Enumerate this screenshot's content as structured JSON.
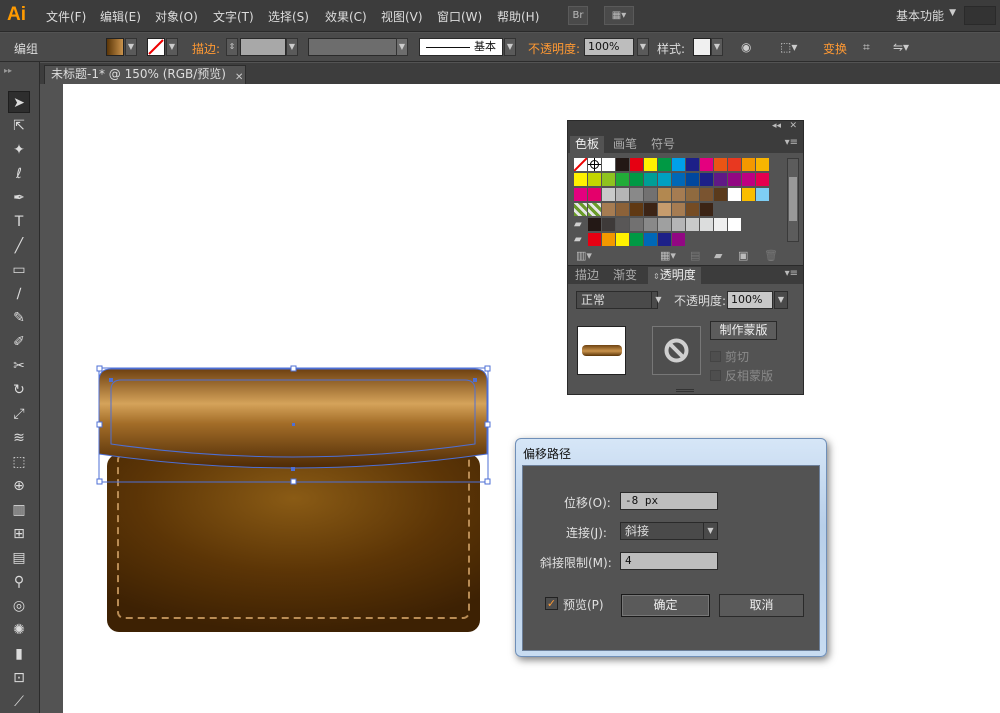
{
  "app": {
    "logo": "Ai"
  },
  "menu": {
    "items": [
      "文件(F)",
      "编辑(E)",
      "对象(O)",
      "文字(T)",
      "选择(S)",
      "效果(C)",
      "视图(V)",
      "窗口(W)",
      "帮助(H)"
    ],
    "bridge_label": "Br",
    "workspace": "基本功能"
  },
  "control": {
    "selection": "编组",
    "stroke_label": "描边:",
    "stroke_style": "基本",
    "opacity_label": "不透明度:",
    "opacity_value": "100%",
    "style_label": "样式:",
    "transform_label": "变换"
  },
  "document": {
    "tab_title": "未标题-1* @ 150% (RGB/预览)"
  },
  "tools": [
    "selection-tool",
    "direct-selection-tool",
    "magic-wand-tool",
    "lasso-tool",
    "pen-tool",
    "type-tool",
    "line-tool",
    "rectangle-tool",
    "paintbrush-tool",
    "pencil-tool",
    "blob-brush-tool",
    "scissors-tool",
    "rotate-tool",
    "scale-tool",
    "width-tool",
    "free-transform-tool",
    "shape-builder-tool",
    "perspective-grid-tool",
    "mesh-tool",
    "gradient-tool",
    "eyedropper-tool",
    "blend-tool",
    "symbol-sprayer-tool",
    "column-graph-tool",
    "artboard-tool",
    "slice-tool"
  ],
  "swatches": {
    "tabs": [
      "色板",
      "画笔",
      "符号"
    ],
    "rows": [
      [
        "none",
        "registration",
        "#ffffff",
        "#231815",
        "#e60012",
        "#fff100",
        "#009944",
        "#00a0e9",
        "#1d2088",
        "#e4007f",
        "#ea5514",
        "#e83820",
        "#f39800",
        "#f8b500"
      ],
      [
        "#fff100",
        "#c3d600",
        "#8fc31f",
        "#22ac38",
        "#009944",
        "#009e96",
        "#00a0c1",
        "#0068b7",
        "#00479d",
        "#1d2088",
        "#601986",
        "#920783",
        "#be0081",
        "#e5004f"
      ],
      [
        "#e4007f",
        "#e4006b",
        "#c9caca",
        "#b5b5b6",
        "#898989",
        "#727171",
        "#b28850",
        "#a57c52",
        "#8f6a3f",
        "#7a5430",
        "#5a3a1c",
        "#ffffff",
        "#fabe00",
        "#7ecef4"
      ],
      [
        "pattern",
        "pattern",
        "#a67c52",
        "#8c6239",
        "#603913",
        "#3c2415",
        "#c69c6d",
        "#a67c52",
        "#754c24",
        "#3c2415"
      ],
      [
        "folder",
        "#231815",
        "#3e3a39",
        "#595757",
        "#727171",
        "#898989",
        "#9fa0a0",
        "#b5b5b6",
        "#c9caca",
        "#dcdddd",
        "#efefef",
        "#ffffff"
      ],
      [
        "folder",
        "#e60012",
        "#f39800",
        "#fff100",
        "#009944",
        "#0068b7",
        "#1d2088",
        "#920783"
      ]
    ]
  },
  "transparency": {
    "tabs": [
      "描边",
      "渐变",
      "透明度"
    ],
    "blend_mode": "正常",
    "opacity_label": "不透明度:",
    "opacity_value": "100%",
    "make_mask": "制作蒙版",
    "clip": "剪切",
    "invert_mask": "反相蒙版"
  },
  "dialog": {
    "title": "偏移路径",
    "offset_label": "位移(O):",
    "offset_value": "-8 px",
    "joins_label": "连接(J):",
    "joins_value": "斜接",
    "miter_label": "斜接限制(M):",
    "miter_value": "4",
    "preview_label": "预览(P)",
    "preview_checked": "✓",
    "ok": "确定",
    "cancel": "取消"
  },
  "colors": {
    "accent": "#ff9a00",
    "selection": "#4d6fd6",
    "bag_dark": "#4a2a06",
    "bag_light": "#d8a55c"
  }
}
